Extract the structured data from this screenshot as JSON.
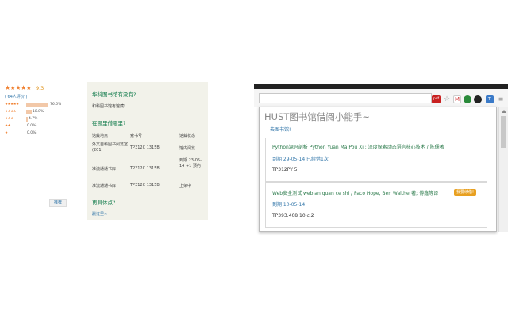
{
  "rating": {
    "stars": "★★★★★",
    "score": "9.3",
    "count_text": "( 64人评价 )",
    "distribution": [
      {
        "stars": "★★★★★",
        "percent_text": "76.6%",
        "fraction": 0.766
      },
      {
        "stars": "★★★★",
        "percent_text": "18.8%",
        "fraction": 0.188
      },
      {
        "stars": "★★★",
        "percent_text": "4.7%",
        "fraction": 0.047
      },
      {
        "stars": "★★",
        "percent_text": "0.0%",
        "fraction": 0.0
      },
      {
        "stars": "★",
        "percent_text": "0.0%",
        "fraction": 0.0
      }
    ],
    "small_button_label": "推荐"
  },
  "library": {
    "q1_title": "华科图书馆有没有?",
    "q1_answer": "和科图书馆有馆藏!",
    "q2_title": "在哪里借哪里?",
    "headers": [
      "馆藏地点",
      "索书号",
      "馆藏状态"
    ],
    "rows": [
      {
        "location": "外文自科图书阅览室(201)",
        "call": "TP312C 1315B",
        "status": "馆内阅览"
      },
      {
        "location": "准流通通书库",
        "call": "TP312C 1315B",
        "status": "到期 23-05-14 +1 预约"
      },
      {
        "location": "准流通通书库",
        "call": "TP312C 1315B",
        "status": "上架中"
      }
    ],
    "q3_title": "再具体点?",
    "more_link": "戳这里~"
  },
  "browser": {
    "toolbar_icons": [
      "pdf-icon",
      "star-icon",
      "gmail-icon",
      "evernote-icon",
      "circle-icon",
      "extension-icon",
      "menu-icon"
    ],
    "popup": {
      "title": "HUST图书馆借阅小能手~",
      "goto_library": "去图书馆!",
      "books": [
        {
          "title": "Python源码剖析 Python Yuan Ma Pou Xi : 深度探索动态语言核心技术 / 陈儒著",
          "due": "到期 29-05-14 已续借1次",
          "call": "TP312PY 5"
        },
        {
          "title": "Web安全测试 web an quan ce shi / Paco Hope, Ben Walther著; 傅鑫等译",
          "renew": "我要续借!",
          "due": "到期 10-05-14",
          "call": "TP393.408 10 c.2"
        }
      ]
    }
  }
}
